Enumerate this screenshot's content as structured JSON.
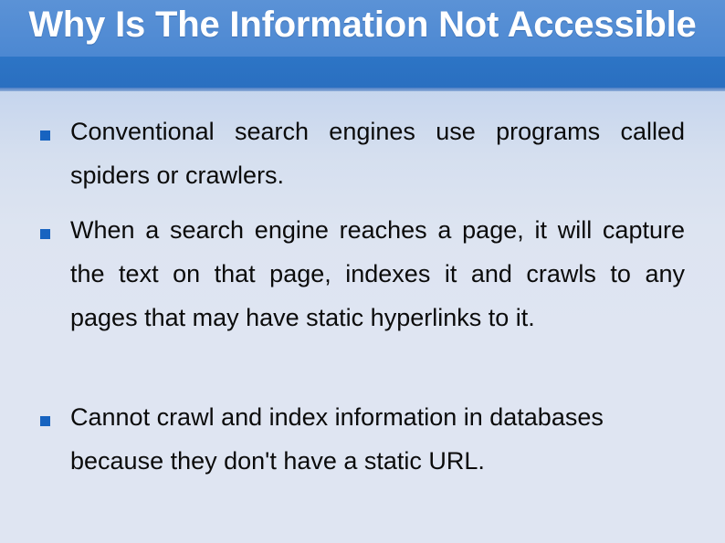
{
  "slide": {
    "title": "Why Is The Information Not Accessible",
    "title_lines": [
      "Why Is The Information Not",
      "Accessible"
    ],
    "colors": {
      "band_top": "#4f8bd4",
      "band_bottom": "#2a72c5",
      "title_text": "#ffffff",
      "body_text": "#0b0b0b",
      "bullet_marker": "#1763c0",
      "body_background_top": "#b5cbea",
      "body_background_bottom": "#dfe5f2"
    },
    "bullets": [
      {
        "marker": "square-bullet-icon",
        "text": "Conventional search engines use programs called spiders or crawlers."
      },
      {
        "marker": "square-bullet-icon",
        "text": "When a search engine  reaches a  page,  it will capture the text on that page, indexes it  and crawls to any pages that may have static hyperlinks to it."
      },
      {
        "marker": "square-bullet-icon",
        "text": "Cannot crawl and index information in databases because they don't have a static URL."
      }
    ]
  }
}
